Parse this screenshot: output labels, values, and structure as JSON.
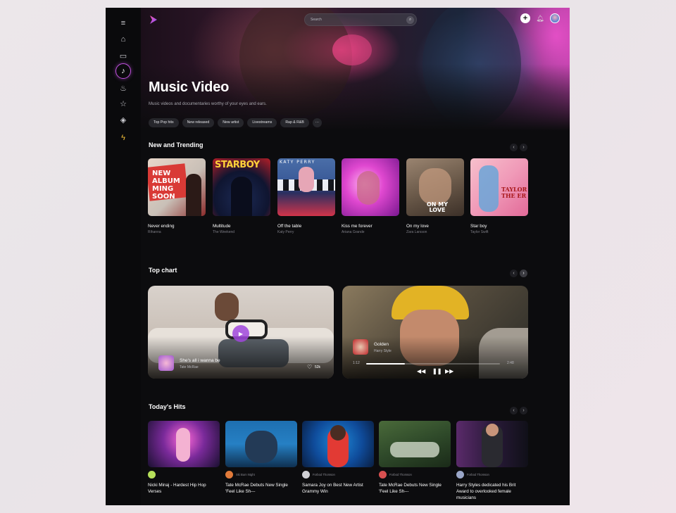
{
  "search": {
    "placeholder": "Search"
  },
  "hero": {
    "title": "Music Video",
    "subtitle": "Music videos and documentaries worthy of your eyes and ears.",
    "chips": [
      "Top Pop hits",
      "New released",
      "New artist",
      "Livestreams",
      "Rap & R&B",
      "···"
    ]
  },
  "sidebar": {
    "items": [
      {
        "icon": "menu-icon",
        "glyph": "≡"
      },
      {
        "icon": "home-icon",
        "glyph": "⌂"
      },
      {
        "icon": "tv-icon",
        "glyph": "▭"
      },
      {
        "icon": "music-note-icon",
        "glyph": "♪"
      },
      {
        "icon": "fire-icon",
        "glyph": "♨"
      },
      {
        "icon": "star-icon",
        "glyph": "☆"
      },
      {
        "icon": "layers-icon",
        "glyph": "◈"
      },
      {
        "icon": "bolt-icon",
        "glyph": "ϟ"
      }
    ]
  },
  "trending": {
    "title": "New and Trending",
    "items": [
      {
        "title": "Never ending",
        "artist": "Rihanna",
        "art_text": "NEW ALBUM MING SOON"
      },
      {
        "title": "Multitude",
        "artist": "The Weekend",
        "art_text": "STARBOY"
      },
      {
        "title": "Off the table",
        "artist": "Katy Perry",
        "art_text": "KATY PERRY"
      },
      {
        "title": "Kiss me forever",
        "artist": "Ariana Grande",
        "art_text": ""
      },
      {
        "title": "On my love",
        "artist": "Zara Larsson",
        "art_text": "ON MY LOVE"
      },
      {
        "title": "Star boy",
        "artist": "Taylor Swift",
        "art_text": "TAYLOR THE ER"
      }
    ]
  },
  "top_chart": {
    "title": "Top chart",
    "left": {
      "title": "She's all i wanna be",
      "artist": "Tate McRae",
      "likes": "52k"
    },
    "right": {
      "title": "Golden",
      "artist": "Harry Style",
      "time_current": "1:12",
      "time_total": "2:48",
      "progress": 0.29
    }
  },
  "hits": {
    "title": "Today's Hits",
    "items": [
      {
        "source": "",
        "title": "Nicki Minaj - Hardest Hip Hop Verses"
      },
      {
        "source": "Ski Bum Ntght",
        "title": "Tate McRae Debuts New Single 'Feel Like Sh---"
      },
      {
        "source": "Forbod Thomson",
        "title": "Samara Joy on Best New Artist Grammy Win"
      },
      {
        "source": "Forbod Thomson",
        "title": "Tate McRae Debuts New Single 'Feel Like Sh---"
      },
      {
        "source": "Forbod Thomson",
        "title": "Harry Styles dedicated his Brit Award to overlooked female musicians"
      }
    ]
  },
  "colors": {
    "accent": "#c252e0",
    "background": "#0c0c0e",
    "bolt": "#f6c23a"
  }
}
